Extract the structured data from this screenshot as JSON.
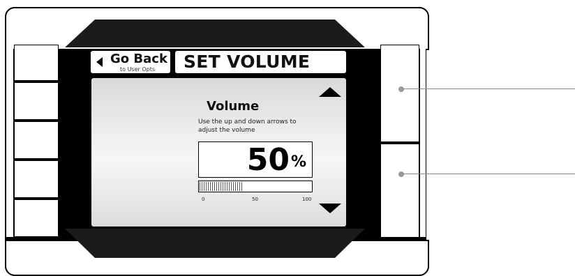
{
  "header": {
    "back_label": "Go Back",
    "back_sublabel": "to User Opts",
    "title": "SET VOLUME"
  },
  "volume": {
    "heading": "Volume",
    "description": "Use the up and down arrows to adjust the volume",
    "value": "50",
    "unit": "%",
    "level_fraction": 0.5,
    "scale": {
      "min": "0",
      "mid": "50",
      "max": "100"
    }
  },
  "icons": {
    "up": "up-arrow-icon",
    "down": "down-arrow-icon",
    "back": "back-triangle-icon"
  },
  "colors": {
    "screen_bg": "#eeeeee",
    "bezel": "#000000",
    "bar_fill": "#555555",
    "callout": "#8a8a8a"
  }
}
